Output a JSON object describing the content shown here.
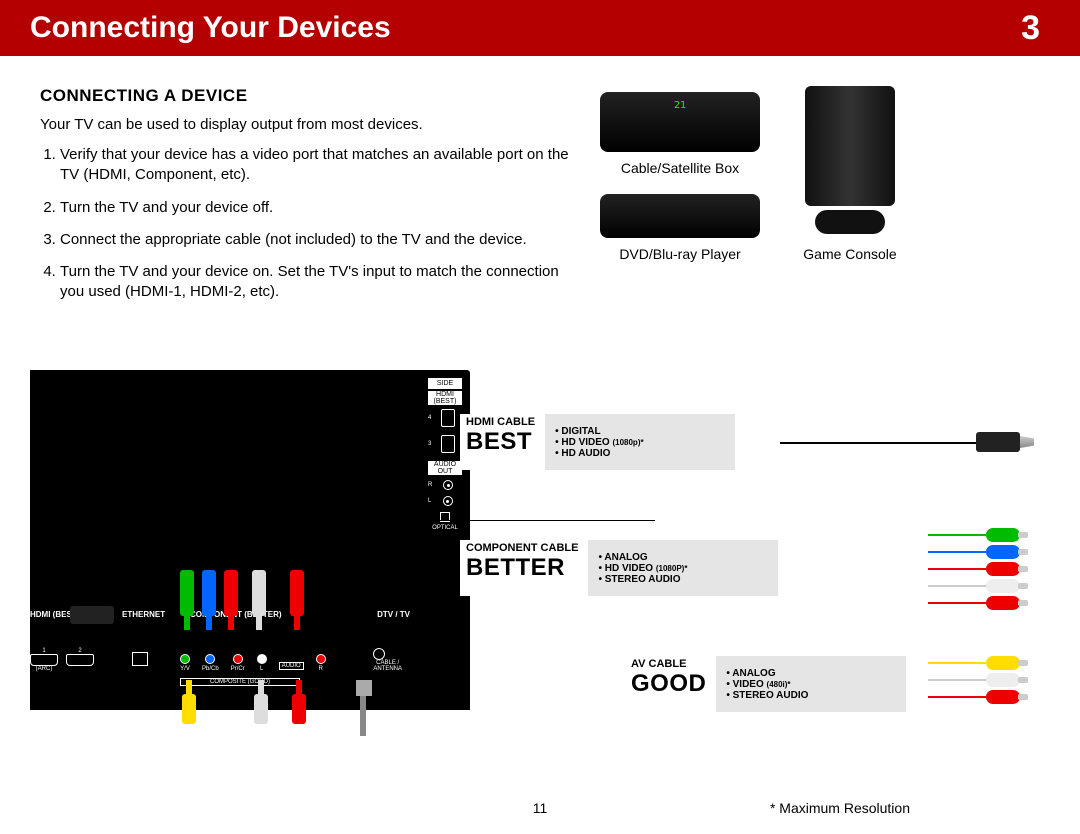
{
  "header": {
    "title": "Connecting Your Devices",
    "chapter_number": "3"
  },
  "section": {
    "title": "CONNECTING A DEVICE",
    "intro": "Your TV can be used to display output from most devices.",
    "steps": [
      "Verify that your device has a video port that matches an available port on the TV (HDMI, Component, etc).",
      "Turn the TV and your device off.",
      "Connect the appropriate cable (not included) to the TV and the device.",
      "Turn the TV and your device on. Set the TV's input to match the connection you used (HDMI-1, HDMI-2, etc)."
    ]
  },
  "devices": {
    "cable_box": "Cable/Satellite Box",
    "cable_box_display": "21",
    "dvd": "DVD/Blu-ray Player",
    "console": "Game Console"
  },
  "panel": {
    "side_title": "SIDE",
    "hdmi_side_label": "HDMI",
    "hdmi_side_sub": "(BEST)",
    "hdmi4": "4",
    "hdmi3": "3",
    "audio_out": "AUDIO",
    "audio_out2": "OUT",
    "audio_r": "R",
    "audio_l": "L",
    "optical": "OPTICAL",
    "rear_hdmi_title": "HDMI (BEST)",
    "hdmi1": "1",
    "hdmi2": "2",
    "arc": "(ARC)",
    "ethernet": "ETHERNET",
    "component_title": "COMPONENT (BETTER)",
    "ypbpr_y": "Y/V",
    "ypbpr_pb": "Pb/Cb",
    "ypbpr_pr": "Pr/Cr",
    "audio_l2": "L",
    "audio_lbl": "AUDIO",
    "audio_r2": "R",
    "composite_sub": "COMPOSITE (GOOD)",
    "dtv": "DTV / TV",
    "cable_ant": "CABLE /",
    "cable_ant2": "ANTENNA"
  },
  "callouts": {
    "best": {
      "cable": "HDMI CABLE",
      "rank": "BEST",
      "feat1": "DIGITAL",
      "feat2": "HD VIDEO",
      "feat2_sub": "(1080p)*",
      "feat3": "HD AUDIO"
    },
    "better": {
      "cable": "COMPONENT CABLE",
      "rank": "BETTER",
      "feat1": "ANALOG",
      "feat2": "HD VIDEO",
      "feat2_sub": "(1080P)*",
      "feat3": "STEREO AUDIO"
    },
    "good": {
      "cable": "AV CABLE",
      "rank": "GOOD",
      "feat1": "ANALOG",
      "feat2": "VIDEO",
      "feat2_sub": "(480i)*",
      "feat3": "STEREO AUDIO"
    }
  },
  "footer": {
    "page": "11",
    "note": "* Maximum Resolution"
  }
}
